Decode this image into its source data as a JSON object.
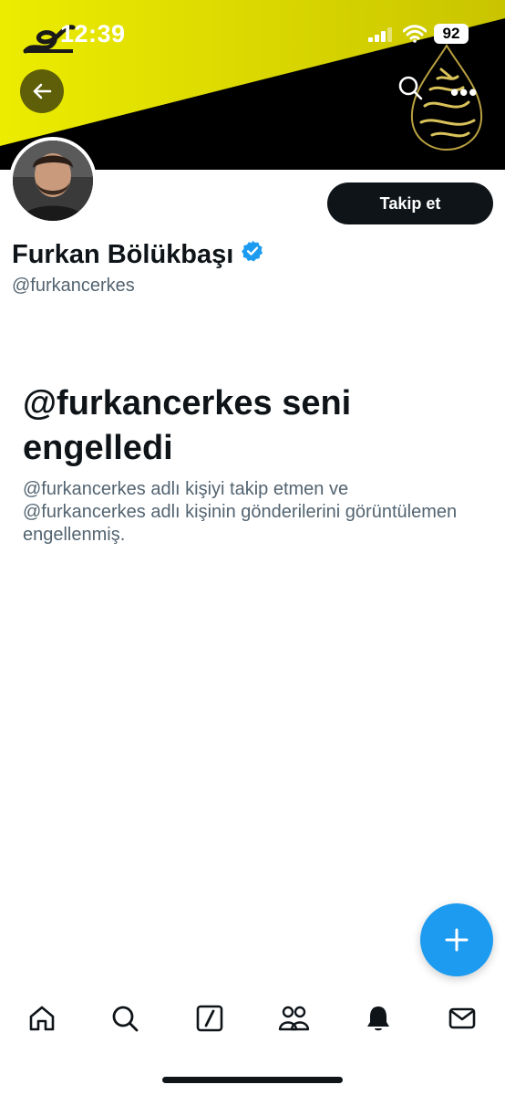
{
  "status_bar": {
    "time": "12:39",
    "battery": "92"
  },
  "header": {
    "back_icon": "arrow-left-icon",
    "search_icon": "search-icon",
    "more_label": "•••",
    "banner_colors": {
      "yellow": "#e6e600",
      "black": "#000000"
    }
  },
  "profile": {
    "display_name": "Furkan Bölükbaşı",
    "handle": "@furkancerkes",
    "verified": true,
    "follow_label": "Takip et"
  },
  "blocked": {
    "title": "@furkancerkes seni engelledi",
    "description": "@furkancerkes adlı kişiyi takip etmen ve @furkancerkes adlı kişinin gönderilerini görüntülemen engellenmiş."
  },
  "fab": {
    "icon": "plus-icon"
  },
  "bottom_nav": {
    "items": [
      "home-icon",
      "search-icon",
      "grok-icon",
      "communities-icon",
      "notifications-icon",
      "messages-icon"
    ]
  },
  "colors": {
    "accent": "#1d9bf0",
    "text_primary": "#0f1419",
    "text_secondary": "#536471"
  }
}
